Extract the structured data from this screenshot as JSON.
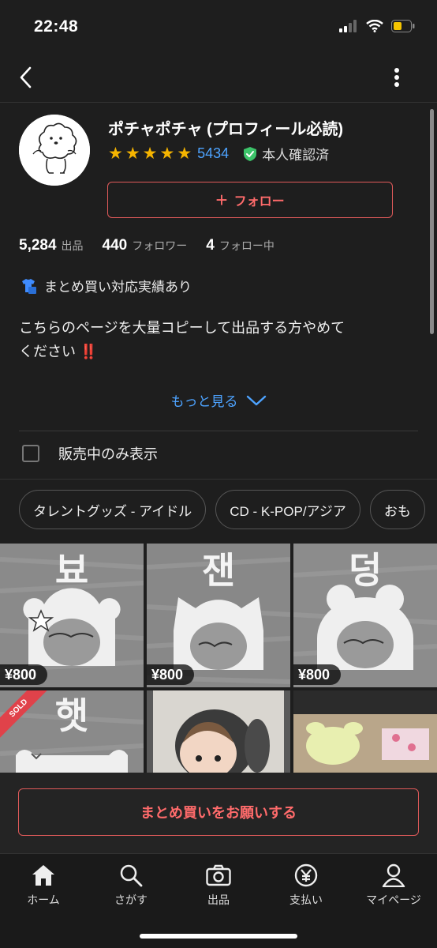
{
  "status_bar": {
    "time": "22:48"
  },
  "shop": {
    "name": "ポチャポチャ (プロフィール必読)",
    "rating_count": "5434",
    "verified_label": "本人確認済",
    "follow_label": "フォロー",
    "stars": 5
  },
  "stats": [
    {
      "value": "5,284",
      "label": "出品"
    },
    {
      "value": "440",
      "label": "フォロワー"
    },
    {
      "value": "4",
      "label": "フォロー中"
    }
  ],
  "bulk_note": "まとめ買い対応実績あり",
  "description": {
    "line1": "こちらのページを大量コピーして出品する方やめて",
    "line2": "ください",
    "emoji": "‼️"
  },
  "more_label": "もっと見る",
  "filter": {
    "label": "販売中のみ表示",
    "checked": false
  },
  "chips": [
    "タレントグッズ - アイドル",
    "CD - K-POP/アジア",
    "おも"
  ],
  "items": [
    {
      "glyph": "뵤",
      "price": "¥800",
      "sold": false
    },
    {
      "glyph": "잰",
      "price": "¥800",
      "sold": false
    },
    {
      "glyph": "덩",
      "price": "¥800",
      "sold": false
    },
    {
      "glyph": "햇",
      "price": "",
      "sold": true,
      "sold_label": "SOLD"
    },
    {
      "glyph": "",
      "price": "",
      "sold": false
    },
    {
      "glyph": "",
      "price": "",
      "sold": false
    }
  ],
  "bulk_button": "まとめ買いをお願いする",
  "tabs": [
    {
      "label": "ホーム",
      "icon": "home-icon"
    },
    {
      "label": "さがす",
      "icon": "search-icon"
    },
    {
      "label": "出品",
      "icon": "camera-icon"
    },
    {
      "label": "支払い",
      "icon": "yen-icon"
    },
    {
      "label": "マイページ",
      "icon": "person-icon"
    }
  ],
  "colors": {
    "accent": "#e05a5a",
    "link": "#4da3ff",
    "star": "#f5b400",
    "verified": "#3cc46a",
    "background": "#1e1e1e"
  }
}
